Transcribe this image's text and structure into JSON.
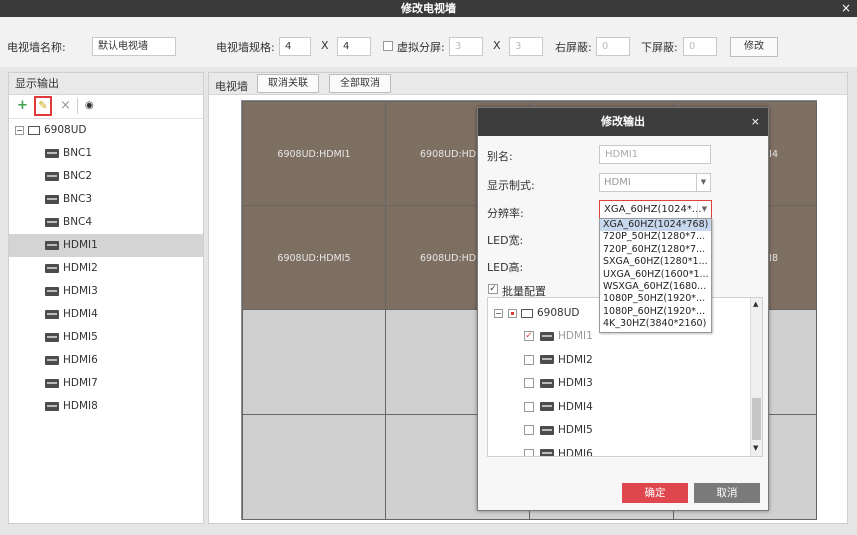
{
  "window": {
    "title": "修改电视墙",
    "close": "×"
  },
  "topbar": {
    "name_label": "电视墙名称:",
    "name_value": "默认电视墙",
    "spec_label": "电视墙规格:",
    "rows": "4",
    "x1": "X",
    "cols": "4",
    "virtual_label": "虚拟分屏:",
    "v_rows": "3",
    "x2": "X",
    "v_cols": "3",
    "right_label": "右屏蔽:",
    "right_value": "0",
    "bottom_label": "下屏蔽:",
    "bottom_value": "0",
    "modify": "修改"
  },
  "left": {
    "header": "显示输出",
    "tools": {
      "add": "+",
      "edit": "✎",
      "delete": "×",
      "view": "◉"
    },
    "root": "6908UD",
    "items": [
      {
        "label": "BNC1"
      },
      {
        "label": "BNC2"
      },
      {
        "label": "BNC3"
      },
      {
        "label": "BNC4"
      },
      {
        "label": "HDMI1"
      },
      {
        "label": "HDMI2"
      },
      {
        "label": "HDMI3"
      },
      {
        "label": "HDMI4"
      },
      {
        "label": "HDMI5"
      },
      {
        "label": "HDMI6"
      },
      {
        "label": "HDMI7"
      },
      {
        "label": "HDMI8"
      }
    ],
    "selected": "HDMI1"
  },
  "right": {
    "header": "电视墙",
    "unlink": "取消关联",
    "cancel_all": "全部取消",
    "cells": [
      "6908UD:HDMI1",
      "6908UD:HDMI2",
      "",
      "6908UD:HDMI4",
      "6908UD:HDMI5",
      "6908UD:HDMI6",
      "",
      "6908UD:HDMI8"
    ],
    "cell_fragments": {
      "c2": "6908UD:HD",
      "c4": "MI4",
      "c6": "6908UD:HD",
      "c8": "MI8"
    }
  },
  "dialog": {
    "title": "修改输出",
    "close": "×",
    "alias_label": "别名:",
    "alias_value": "HDMI1",
    "format_label": "显示制式:",
    "format_value": "HDMI",
    "resolution_label": "分辨率:",
    "resolution_value": "XGA_60HZ(1024*...",
    "led_w_label": "LED宽:",
    "led_h_label": "LED高:",
    "batch_label": "批量配置",
    "resolution_options": [
      "XGA_60HZ(1024*768)",
      "720P_50HZ(1280*7...",
      "720P_60HZ(1280*7...",
      "SXGA_60HZ(1280*1...",
      "UXGA_60HZ(1600*1...",
      "WSXGA_60HZ(1680...",
      "1080P_50HZ(1920*...",
      "1080P_60HZ(1920*...",
      "4K_30HZ(3840*2160)"
    ],
    "tree_root": "6908UD",
    "tree_items": [
      "HDMI1",
      "HDMI2",
      "HDMI3",
      "HDMI4",
      "HDMI5",
      "HDMI6"
    ],
    "ok": "确定",
    "cancel": "取消"
  },
  "colors": {
    "tile_on": "#7e6f63",
    "accent_red": "#e0464d"
  }
}
